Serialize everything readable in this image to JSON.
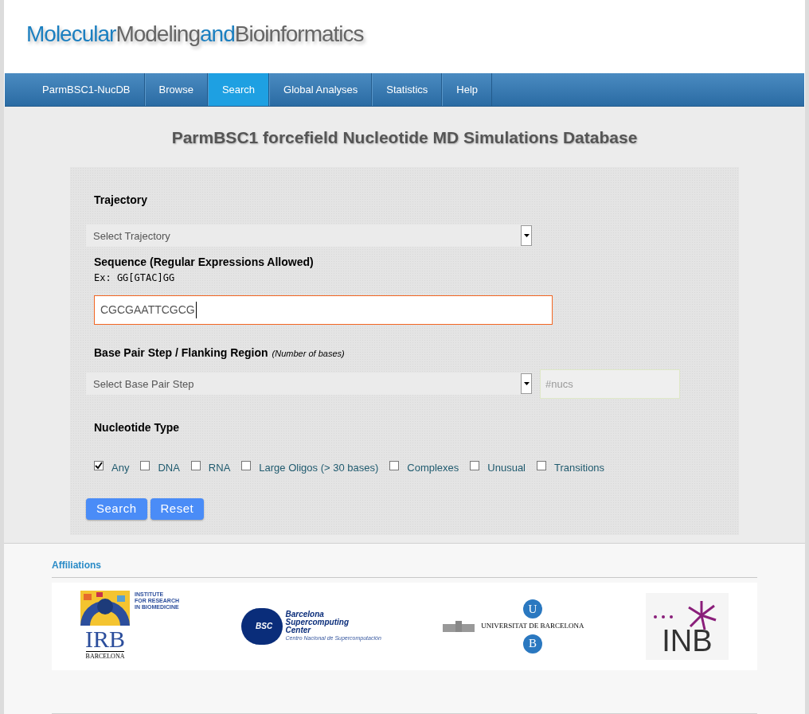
{
  "logo": [
    {
      "text": "Molecular",
      "color": "#1b7fc0"
    },
    {
      "text": "Modeling",
      "color": "#666666"
    },
    {
      "text": "and",
      "color": "#1b7fc0"
    },
    {
      "text": "Bioinformatics",
      "color": "#666666"
    }
  ],
  "nav": [
    {
      "label": "ParmBSC1-NucDB",
      "selected": false
    },
    {
      "label": "Browse",
      "selected": false
    },
    {
      "label": "Search",
      "selected": true
    },
    {
      "label": "Global Analyses",
      "selected": false
    },
    {
      "label": "Statistics",
      "selected": false
    },
    {
      "label": "Help",
      "selected": false
    }
  ],
  "page_title": "ParmBSC1 forcefield Nucleotide MD Simulations Database",
  "form": {
    "trajectory": {
      "label": "Trajectory",
      "placeholder": "Select Trajectory"
    },
    "sequence": {
      "label": "Sequence (Regular Expressions Allowed)",
      "example": "Ex: GG[GTAC]GG",
      "value": "CGCGAATTCGCG"
    },
    "base_pair": {
      "label": "Base Pair Step / Flanking Region",
      "note": "(Number of bases)",
      "placeholder": "Select Base Pair Step",
      "nucs_placeholder": "#nucs"
    },
    "nucleotide_type": {
      "label": "Nucleotide Type",
      "options": [
        {
          "label": "Any",
          "checked": true
        },
        {
          "label": "DNA",
          "checked": false
        },
        {
          "label": "RNA",
          "checked": false
        },
        {
          "label": "Large Oligos (> 30 bases)",
          "checked": false
        },
        {
          "label": "Complexes",
          "checked": false
        },
        {
          "label": "Unusual",
          "checked": false
        },
        {
          "label": "Transitions",
          "checked": false
        }
      ]
    },
    "buttons": [
      "Search",
      "Reset"
    ]
  },
  "affiliations": {
    "title": "Affiliations",
    "logos": [
      {
        "kind": "irb",
        "texts": [
          "INSTITUTE",
          "FOR RESEARCH",
          "IN BIOMEDICINE",
          "IRB",
          "BARCELONA"
        ]
      },
      {
        "kind": "bsc",
        "texts": [
          "BSC",
          "Barcelona",
          "Supercomputing",
          "Center",
          "Centro Nacional de Supercomputación"
        ]
      },
      {
        "kind": "ub",
        "texts": [
          "U",
          "UNIVERSITAT DE BARCELONA",
          "B"
        ]
      },
      {
        "kind": "inb",
        "texts": [
          "INB"
        ]
      }
    ]
  }
}
